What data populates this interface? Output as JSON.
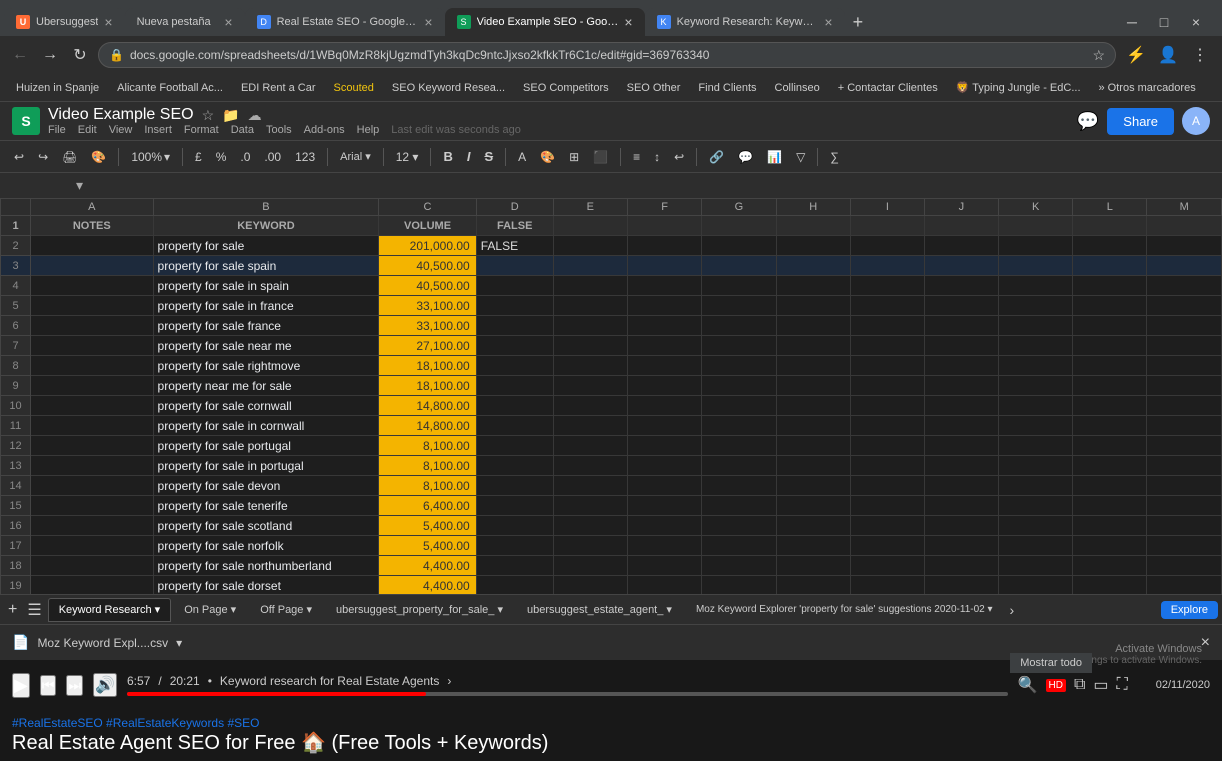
{
  "browser": {
    "tabs": [
      {
        "id": "ubersuggest",
        "label": "Ubersuggest",
        "active": false,
        "icon": "U"
      },
      {
        "id": "nueva-pestana",
        "label": "Nueva pestaña",
        "active": false,
        "icon": "N"
      },
      {
        "id": "google-drive",
        "label": "Real Estate SEO - Google Drive",
        "active": false,
        "icon": "D"
      },
      {
        "id": "video-seo",
        "label": "Video Example SEO - Google Sh...",
        "active": true,
        "icon": "S"
      },
      {
        "id": "keyword-research",
        "label": "Keyword Research: Keyword Sus...",
        "active": false,
        "icon": "K"
      }
    ],
    "url": "docs.google.com/spreadsheets/d/1WBq0MzR8kjUgzmdTyh3kqDc9ntcJjxso2kfkkTr6C1c/edit#gid=369763340",
    "bookmarks": [
      "Huizen in Spanje",
      "Alicante Football Ac...",
      "EDI Rent a Car",
      "Scouted",
      "SEO Keyword Resea...",
      "SEO Competitors",
      "SEO Other",
      "Find Clients",
      "Collinseo",
      "Contactar Clientes",
      "Typing Jungle - EdC...",
      "Otros marcadores"
    ]
  },
  "sheets": {
    "title": "Video Example SEO",
    "menu": [
      "File",
      "Edit",
      "View",
      "Insert",
      "Format",
      "Data",
      "Tools",
      "Add-ons",
      "Help"
    ],
    "last_edit": "Last edit was seconds ago",
    "zoom": "100%",
    "share_label": "Share",
    "formula_bar": {
      "cell_ref": "",
      "formula": ""
    },
    "columns": {
      "headers": [
        "NOTES",
        "KEYWORD",
        "VOLUME",
        "FALSE",
        "E",
        "F",
        "G",
        "H",
        "I",
        "J",
        "K",
        "L",
        "M"
      ],
      "col_letters": [
        "A",
        "B",
        "C",
        "D",
        "E",
        "F",
        "G",
        "H",
        "I",
        "J",
        "K",
        "L",
        "M"
      ]
    },
    "rows": [
      {
        "row": 2,
        "notes": "",
        "keyword": "property for sale",
        "volume": "201,000.00",
        "false_val": ""
      },
      {
        "row": 3,
        "notes": "",
        "keyword": "property for sale spain",
        "volume": "40,500.00",
        "false_val": "",
        "selected": true
      },
      {
        "row": 4,
        "notes": "",
        "keyword": "property for sale in spain",
        "volume": "40,500.00",
        "false_val": ""
      },
      {
        "row": 5,
        "notes": "",
        "keyword": "property for sale in france",
        "volume": "33,100.00",
        "false_val": ""
      },
      {
        "row": 6,
        "notes": "",
        "keyword": "property for sale france",
        "volume": "33,100.00",
        "false_val": ""
      },
      {
        "row": 7,
        "notes": "",
        "keyword": "property for sale near me",
        "volume": "27,100.00",
        "false_val": ""
      },
      {
        "row": 8,
        "notes": "",
        "keyword": "property for sale rightmove",
        "volume": "18,100.00",
        "false_val": ""
      },
      {
        "row": 9,
        "notes": "",
        "keyword": "property near me for sale",
        "volume": "18,100.00",
        "false_val": ""
      },
      {
        "row": 10,
        "notes": "",
        "keyword": "property for sale cornwall",
        "volume": "14,800.00",
        "false_val": ""
      },
      {
        "row": 11,
        "notes": "",
        "keyword": "property for sale in cornwall",
        "volume": "14,800.00",
        "false_val": ""
      },
      {
        "row": 12,
        "notes": "",
        "keyword": "property for sale portugal",
        "volume": "8,100.00",
        "false_val": ""
      },
      {
        "row": 13,
        "notes": "",
        "keyword": "property for sale in portugal",
        "volume": "8,100.00",
        "false_val": ""
      },
      {
        "row": 14,
        "notes": "",
        "keyword": "property for sale devon",
        "volume": "8,100.00",
        "false_val": ""
      },
      {
        "row": 15,
        "notes": "",
        "keyword": "property for sale tenerife",
        "volume": "6,400.00",
        "false_val": ""
      },
      {
        "row": 16,
        "notes": "",
        "keyword": "property for sale scotland",
        "volume": "5,400.00",
        "false_val": ""
      },
      {
        "row": 17,
        "notes": "",
        "keyword": "property for sale norfolk",
        "volume": "5,400.00",
        "false_val": ""
      },
      {
        "row": 18,
        "notes": "",
        "keyword": "property for sale northumberland",
        "volume": "4,400.00",
        "false_val": ""
      },
      {
        "row": 19,
        "notes": "",
        "keyword": "property for sale dorset",
        "volume": "4,400.00",
        "false_val": ""
      }
    ],
    "header_row": {
      "notes_label": "NOTES",
      "keyword_label": "KEYWORD",
      "volume_label": "VOLUME",
      "false_label": "FALSE"
    },
    "sheet_tabs": [
      "Keyword Research",
      "On Page",
      "Off Page",
      "ubersuggest_property_for_sale_",
      "ubersuggest_estate_agent_",
      "Moz Keyword Explorer 'property for sale' suggestions 2020-11-02"
    ],
    "explore_label": "Explore",
    "activate_windows": "Activate Windows",
    "activate_windows_sub": "Go to Settings to activate Windows.",
    "show_all": "Mostrar todo"
  },
  "video": {
    "file_name": "Moz Keyword Expl....csv",
    "time_current": "6:57",
    "time_total": "20:21",
    "title": "Keyword research for Real Estate Agents",
    "hashtags": "#RealEstateSEO #RealEstateKeywords #SEO",
    "main_title": "Real Estate Agent SEO for Free 🏠 (Free Tools + Keywords)",
    "datetime": "02/11/2020"
  }
}
